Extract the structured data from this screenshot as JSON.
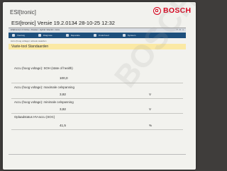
{
  "header": {
    "title": "ESI[tronic]",
    "brand": "BOSCH",
    "logo_icon": "bosch-armature-icon"
  },
  "window": {
    "title": "ESI[tronic] Versie 19.2.0134 28-10-25 12:32"
  },
  "app_bar": {
    "text": "ESI[tronic] 2.0 Online • Dossier • Hybrid / Electric • Accu",
    "controls": [
      "?",
      "▭",
      "×"
    ]
  },
  "nav": {
    "tabs": [
      {
        "label": "Voertuig",
        "icon": "car-icon"
      },
      {
        "label": "Diagnose",
        "icon": "diagnosis-icon"
      },
      {
        "label": "Reparatie",
        "icon": "wrench-icon"
      },
      {
        "label": "Onderhoud",
        "icon": "service-icon"
      },
      {
        "label": "Systeem",
        "icon": "settings-icon"
      }
    ]
  },
  "subtitle": "Accu (hoog voltage): actuele waarden",
  "section": {
    "title": "Vaste-tool Standaarden"
  },
  "values": [
    {
      "label": "Accu (hoog voltage): SOH (state of health)",
      "value": "100,0",
      "unit": ""
    },
    {
      "label": "Accu (hoog voltage): maximale celspanning",
      "value": "3,82",
      "unit": "V"
    },
    {
      "label": "Accu (hoog voltage): minimale celspanning",
      "value": "3,82",
      "unit": "V"
    },
    {
      "label": "Oplaadstatus HV-accu (SOC)",
      "value": "41,5",
      "unit": "%"
    }
  ],
  "watermark": "BOSCH",
  "colors": {
    "brand_red": "#d6001c",
    "nav_blue": "#1d4f7c",
    "highlight_yellow": "#fbe9a4"
  }
}
